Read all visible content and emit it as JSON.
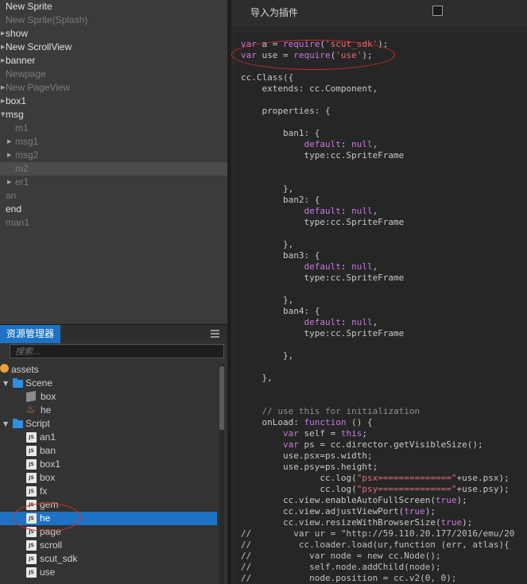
{
  "hierarchy": {
    "nodes": [
      {
        "label": "New Sprite",
        "expandable": false,
        "dim": false
      },
      {
        "label": "New Sprite(Splash)",
        "expandable": false,
        "dim": true
      },
      {
        "label": "show",
        "expandable": true,
        "dim": false
      },
      {
        "label": "New ScrollView",
        "expandable": true,
        "dim": false
      },
      {
        "label": "banner",
        "expandable": true,
        "dim": false
      },
      {
        "label": "Newpage",
        "expandable": false,
        "dim": true
      },
      {
        "label": "New PageView",
        "expandable": true,
        "dim": true
      },
      {
        "label": "box1",
        "expandable": true,
        "dim": false
      },
      {
        "label": "msg",
        "expandable": true,
        "dim": false
      },
      {
        "label": "m1",
        "expandable": false,
        "dim": true
      },
      {
        "label": "msg1",
        "expandable": true,
        "dim": true
      },
      {
        "label": "msg2",
        "expandable": true,
        "dim": true
      },
      {
        "label": "m2",
        "expandable": false,
        "dim": true
      },
      {
        "label": "er1",
        "expandable": true,
        "dim": true
      },
      {
        "label": "an",
        "expandable": false,
        "dim": true
      },
      {
        "label": "end",
        "expandable": false,
        "dim": false
      },
      {
        "label": "man1",
        "expandable": false,
        "dim": true
      }
    ]
  },
  "assets": {
    "tab_label": "资源管理器",
    "search_placeholder": "搜索...",
    "root": "assets",
    "scene_folder": "Scene",
    "scene_items": [
      "box",
      "he"
    ],
    "script_folder": "Script",
    "script_items": [
      "an1",
      "ban",
      "box1",
      "box",
      "fx",
      "gem",
      "he",
      "page",
      "scroll",
      "scut_sdk",
      "use"
    ],
    "selected_item": "he"
  },
  "editor": {
    "plugin_label": "导入为插件",
    "plugin_checked": false
  },
  "colors": {
    "accent": "#1d72c4",
    "annotation": "#d42a2a"
  }
}
